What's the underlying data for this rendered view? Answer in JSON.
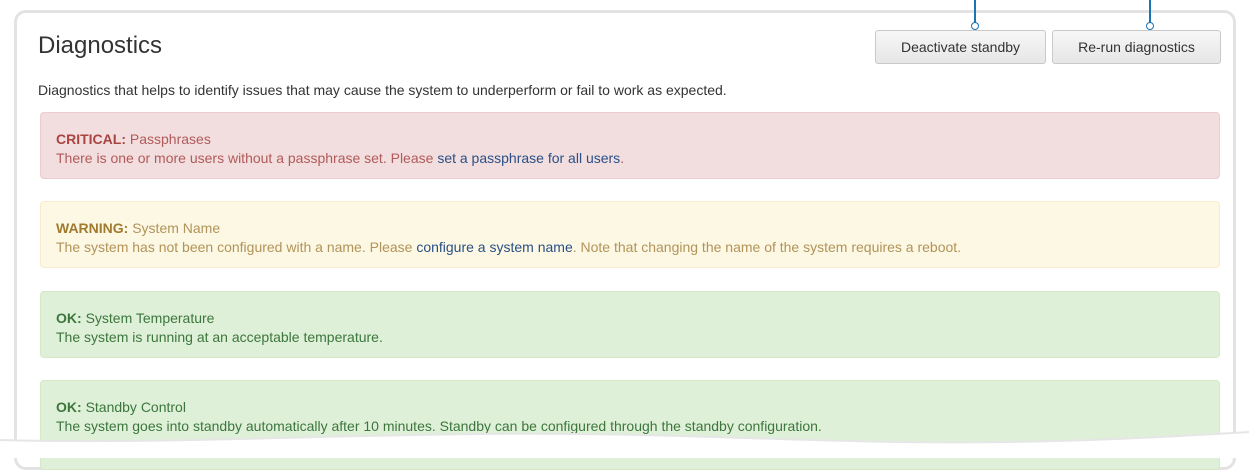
{
  "page": {
    "title": "Diagnostics",
    "description": "Diagnostics that helps to identify issues that may cause the system to underperform or fail to work as expected."
  },
  "buttons": {
    "deactivate_standby": "Deactivate standby",
    "rerun_diagnostics": "Re-run diagnostics"
  },
  "alerts": [
    {
      "level": "CRITICAL:",
      "name": "Passphrases",
      "text_before": "There is one or more users without a passphrase set. Please ",
      "link": "set a passphrase for all users",
      "text_after": "."
    },
    {
      "level": "WARNING:",
      "name": "System Name",
      "text_before": "The system has not been configured with a name. Please ",
      "link": "configure a system name",
      "text_after": ". Note that changing the name of the system requires a reboot."
    },
    {
      "level": "OK:",
      "name": "System Temperature",
      "text_before": "The system is running at an acceptable temperature."
    },
    {
      "level": "OK:",
      "name": "Standby Control",
      "text_before": "The system goes into standby automatically after 10 minutes. Standby can be configured through the standby configuration."
    }
  ],
  "colors": {
    "critical_bg": "#f2dede",
    "warning_bg": "#fcf8e3",
    "ok_bg": "#dff0d8",
    "callout": "#1a73b5"
  }
}
